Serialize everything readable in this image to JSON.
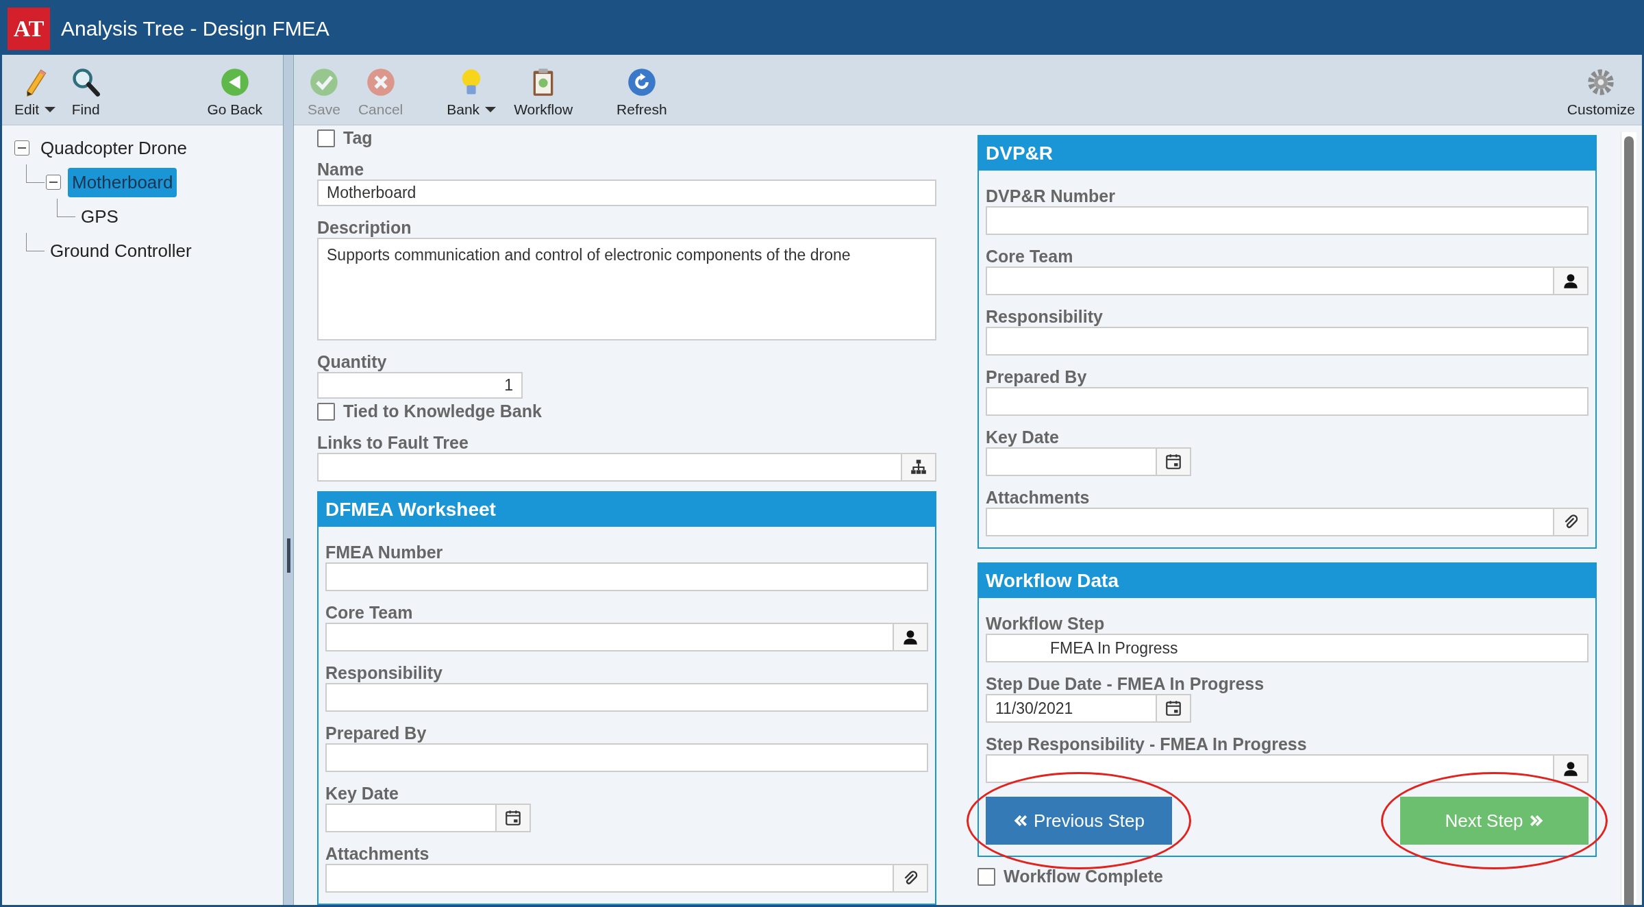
{
  "window": {
    "logo": "AT",
    "title": "Analysis Tree - Design FMEA"
  },
  "tree_toolbar": [
    {
      "kind": "pencil",
      "label": "Edit",
      "dropdown": true,
      "disabled": false
    },
    {
      "kind": "magnifier",
      "label": "Find",
      "dropdown": false,
      "disabled": false
    },
    {
      "kind": "back",
      "label": "Go Back",
      "dropdown": false,
      "disabled": false
    }
  ],
  "toolbar": [
    {
      "kind": "check",
      "label": "Save",
      "dropdown": false,
      "disabled": true
    },
    {
      "kind": "cross",
      "label": "Cancel",
      "dropdown": false,
      "disabled": true
    },
    {
      "kind": "bulb",
      "label": "Bank",
      "dropdown": true,
      "disabled": false
    },
    {
      "kind": "clipboard",
      "label": "Workflow",
      "dropdown": false,
      "disabled": false
    },
    {
      "kind": "refresh",
      "label": "Refresh",
      "dropdown": false,
      "disabled": false
    },
    {
      "kind": "gear",
      "label": "Customize",
      "dropdown": false,
      "disabled": false
    }
  ],
  "tree": [
    {
      "label": "Quadcopter Drone",
      "expanded": true,
      "selected": false,
      "children": [
        {
          "label": "Motherboard",
          "expanded": true,
          "selected": true,
          "children": [
            {
              "label": "GPS",
              "selected": false
            }
          ]
        },
        {
          "label": "Ground Controller",
          "selected": false
        }
      ]
    }
  ],
  "form": {
    "tag": {
      "label": "Tag",
      "checked": false
    },
    "name": {
      "label": "Name",
      "value": "Motherboard"
    },
    "description": {
      "label": "Description",
      "value": "Supports communication and control of electronic components of the drone"
    },
    "quantity": {
      "label": "Quantity",
      "value": "1"
    },
    "tied_to_bank": {
      "label": "Tied to Knowledge Bank",
      "checked": false
    },
    "links": {
      "label": "Links to Fault Tree",
      "kind": "link"
    }
  },
  "dfmea": {
    "title": "DFMEA Worksheet",
    "fields": [
      {
        "label": "FMEA Number",
        "kind": "text"
      },
      {
        "label": "Core Team",
        "kind": "person"
      },
      {
        "label": "Responsibility",
        "kind": "text"
      },
      {
        "label": "Prepared By",
        "kind": "text"
      },
      {
        "label": "Key Date",
        "kind": "date"
      },
      {
        "label": "Attachments",
        "kind": "attachment"
      }
    ]
  },
  "dvpr": {
    "title": "DVP&R",
    "fields": [
      {
        "label": "DVP&R Number",
        "kind": "text"
      },
      {
        "label": "Core Team",
        "kind": "person"
      },
      {
        "label": "Responsibility",
        "kind": "text"
      },
      {
        "label": "Prepared By",
        "kind": "text"
      },
      {
        "label": "Key Date",
        "kind": "date"
      },
      {
        "label": "Attachments",
        "kind": "attachment"
      }
    ]
  },
  "workflow": {
    "title": "Workflow Data",
    "fields": [
      {
        "label": "Workflow Step",
        "kind": "readonly",
        "value": "FMEA In Progress"
      },
      {
        "label": "Step Due Date - FMEA In Progress",
        "kind": "date",
        "value": "11/30/2021"
      },
      {
        "label": "Step Responsibility - FMEA In Progress",
        "kind": "person"
      }
    ],
    "buttons": [
      {
        "kind": "previous",
        "label": "Previous Step",
        "annotated": true
      },
      {
        "kind": "next",
        "label": "Next Step",
        "annotated": true
      }
    ],
    "complete": {
      "label": "Workflow Complete",
      "checked": false
    }
  }
}
